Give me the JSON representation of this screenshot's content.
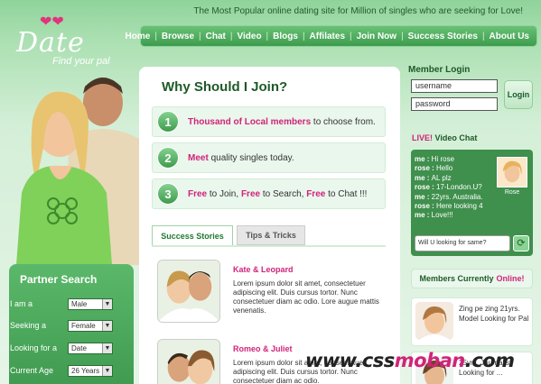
{
  "header": {
    "logo_text": "Date",
    "logo_tagline": "Find your pal",
    "tagline": "The Most Popular online dating site for Million of singles who are seeking for Love!"
  },
  "nav": {
    "items": [
      "Home",
      "Browse",
      "Chat",
      "Video",
      "Blogs",
      "Affilates",
      "Join Now",
      "Success Stories",
      "About Us"
    ]
  },
  "partner_search": {
    "title": "Partner Search",
    "rows": [
      {
        "label": "I am a",
        "value": "Male"
      },
      {
        "label": "Seeking a",
        "value": "Female"
      },
      {
        "label": "Looking for a",
        "value": "Date"
      },
      {
        "label": "Current Age",
        "value": "26 Years"
      }
    ]
  },
  "join": {
    "title": "Why Should I Join?",
    "reasons": [
      {
        "num": "1",
        "highlight": "Thousand of Local members",
        "rest": " to choose from."
      },
      {
        "num": "2",
        "highlight": "Meet",
        "rest": " quality singles today."
      },
      {
        "num": "3",
        "p1": "Free",
        "t1": " to Join, ",
        "p2": "Free",
        "t2": " to Search, ",
        "p3": "Free",
        "t3": " to Chat !!!"
      }
    ]
  },
  "tabs": {
    "success": "Success Stories",
    "tips": "Tips & Tricks"
  },
  "stories": [
    {
      "name": "Kate & Leopard",
      "desc": "Lorem ipsum dolor sit amet, consectetuer adipiscing elit. Duis cursus tortor. Nunc consectetuer diam ac odio. Lore augue mattis venenatis."
    },
    {
      "name": "Romeo & Juliet",
      "desc": "Lorem ipsum dolor sit amet, consectetuer adipiscing elit. Duis cursus tortor. Nunc consectetuer diam ac odio."
    }
  ],
  "member_login": {
    "title": "Member Login",
    "username_value": "username",
    "password_value": "password",
    "button": "Login"
  },
  "video_chat": {
    "live": "LIVE!",
    "title": "Video Chat",
    "messages": [
      {
        "who": "me",
        "text": "Hi rose"
      },
      {
        "who": "rose",
        "text": "Hello"
      },
      {
        "who": "me",
        "text": "AL plz"
      },
      {
        "who": "rose",
        "text": "17-London.U?"
      },
      {
        "who": "me",
        "text": "22yrs. Australia."
      },
      {
        "who": "rose",
        "text": "Here looking 4"
      },
      {
        "who": "me",
        "text": "Love!!!"
      }
    ],
    "photo_name": "Rose",
    "input_value": "Will U looking for same?"
  },
  "members_online": {
    "title": "Members Currently",
    "online": "Online!",
    "members": [
      {
        "text": "Zing pe zing 21yrs. Model Looking for Pal"
      },
      {
        "text": "25yrs. Journalist Looking for ..."
      }
    ]
  },
  "watermark": {
    "a": "www.css",
    "b": "moban",
    "c": ".com"
  },
  "colors": {
    "accent": "#3e9c4d",
    "pink": "#d1237a",
    "bg": "#d4efd7"
  }
}
